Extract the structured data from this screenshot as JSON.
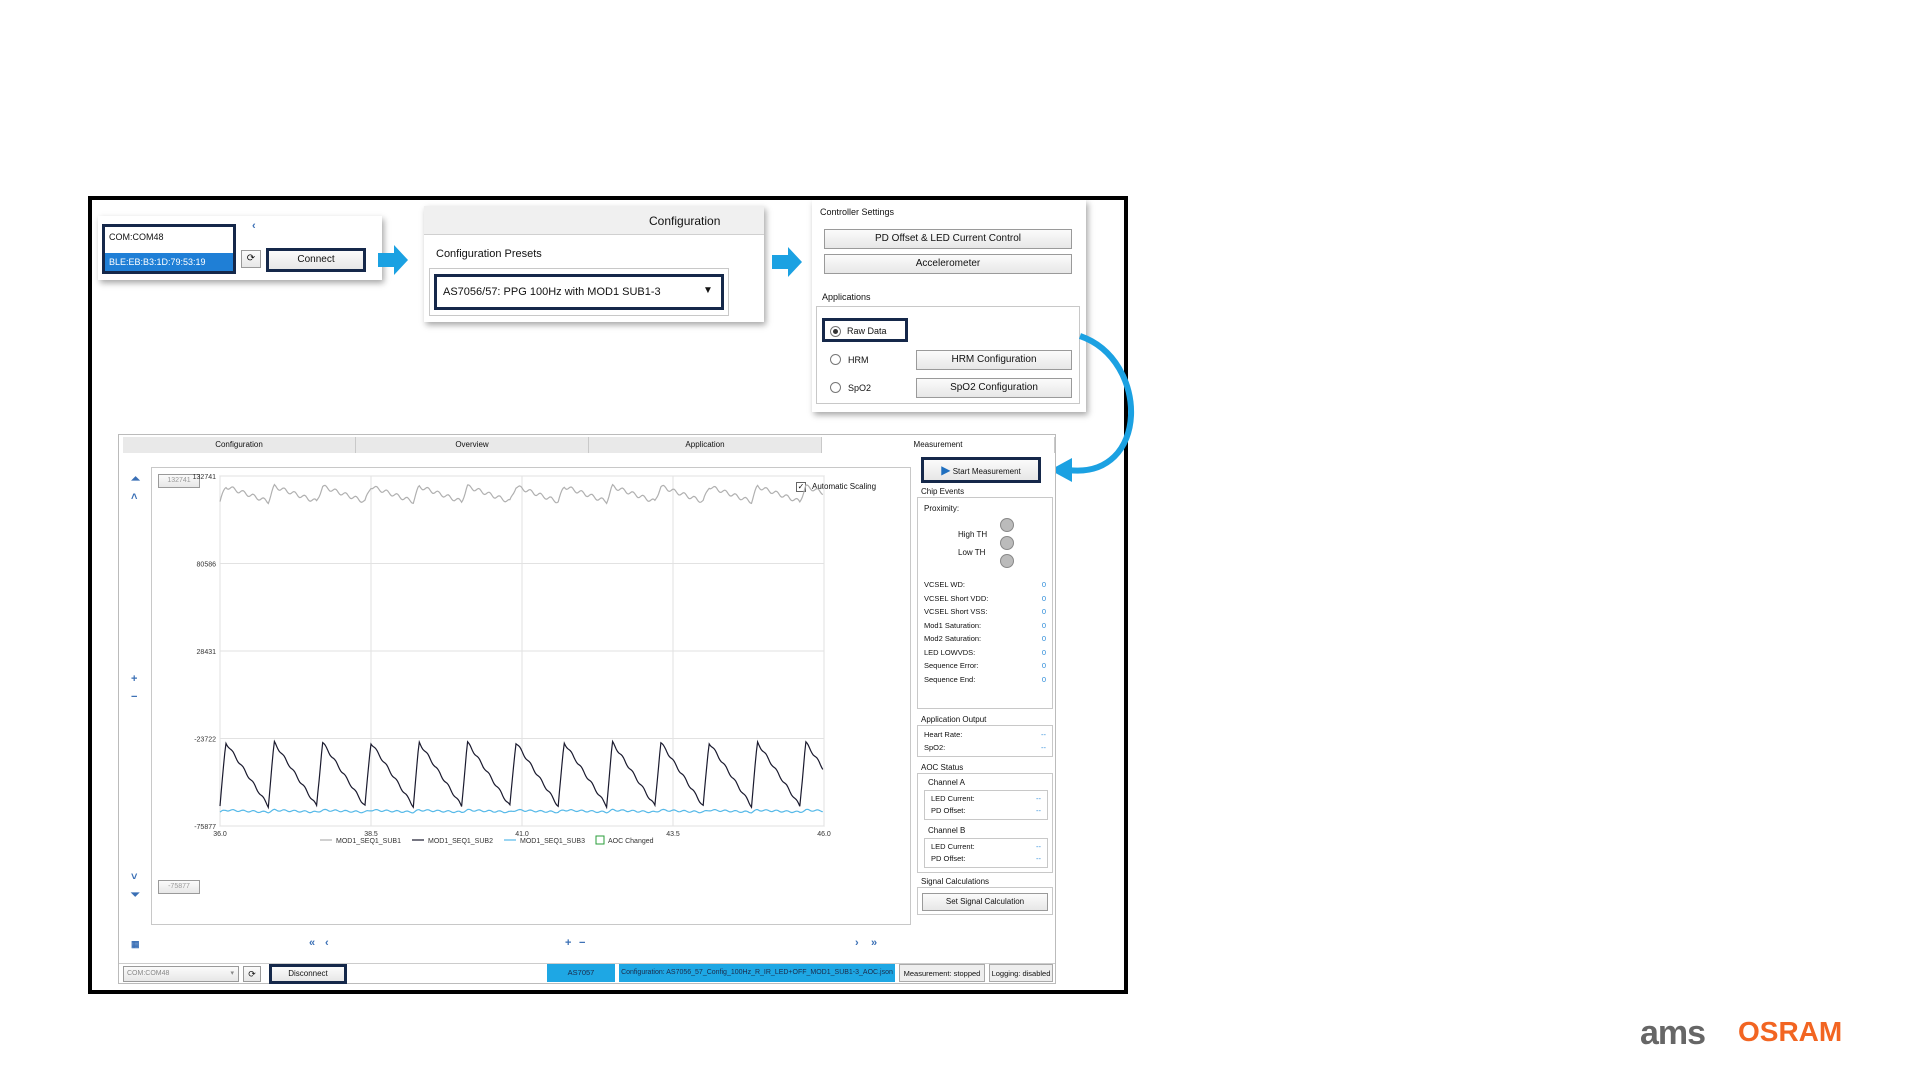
{
  "connection": {
    "port_items": [
      "COM:COM48",
      "BLE:EB:B3:1D:79:53:19"
    ],
    "connect_label": "Connect"
  },
  "configuration": {
    "header": "Configuration",
    "presets_label": "Configuration Presets",
    "preset_value": "AS7056/57: PPG 100Hz with MOD1 SUB1-3"
  },
  "controller": {
    "title": "Controller Settings",
    "pd_offset_label": "PD Offset & LED Current Control",
    "accelerometer_label": "Accelerometer",
    "applications_label": "Applications",
    "apps": [
      {
        "label": "Raw Data",
        "selected": true
      },
      {
        "label": "HRM",
        "selected": false,
        "button": "HRM Configuration"
      },
      {
        "label": "SpO2",
        "selected": false,
        "button": "SpO2 Configuration"
      }
    ]
  },
  "tabs": [
    "Configuration",
    "Overview",
    "Application",
    "Measurement"
  ],
  "chart_controls": {
    "ymax_box": "132741",
    "ymin_box": "-75877",
    "auto_scaling_label": "Automatic Scaling"
  },
  "chart_data": {
    "type": "line",
    "x_ticks": [
      "36.0",
      "38.5",
      "41.0",
      "43.5",
      "46.0"
    ],
    "y_ticks": [
      "132741",
      "80586",
      "28431",
      "-23722",
      "-75877"
    ],
    "xlim": [
      36.0,
      46.0
    ],
    "ylim": [
      -75877,
      132741
    ],
    "series": [
      {
        "name": "MOD1_SEQ1_SUB1",
        "color": "#b0b0b0"
      },
      {
        "name": "MOD1_SEQ1_SUB2",
        "color": "#1a1a2e"
      },
      {
        "name": "MOD1_SEQ1_SUB3",
        "color": "#56b9e8"
      }
    ],
    "extra_legend": "AOC Changed",
    "period": 0.8,
    "sub1": {
      "baseline": 122000,
      "amplitude": 9000
    },
    "sub2": {
      "baseline": -45000,
      "amplitude": 38000
    },
    "sub3": {
      "baseline": -67000,
      "amplitude": 1200
    }
  },
  "right_panel": {
    "start_label": "Start Measurement",
    "chip_events_title": "Chip Events",
    "proximity_label": "Proximity:",
    "high_th": "High TH",
    "low_th": "Low TH",
    "events": [
      {
        "label": "VCSEL WD:",
        "value": "0"
      },
      {
        "label": "VCSEL Short VDD:",
        "value": "0"
      },
      {
        "label": "VCSEL Short VSS:",
        "value": "0"
      },
      {
        "label": "Mod1 Saturation:",
        "value": "0"
      },
      {
        "label": "Mod2 Saturation:",
        "value": "0"
      },
      {
        "label": "LED LOWVDS:",
        "value": "0"
      },
      {
        "label": "Sequence Error:",
        "value": "0"
      },
      {
        "label": "Sequence End:",
        "value": "0"
      }
    ],
    "app_output_title": "Application Output",
    "heart_rate_label": "Heart Rate:",
    "heart_rate_value": "--",
    "spo2_label": "SpO2:",
    "spo2_value": "--",
    "aoc_title": "AOC Status",
    "channel_a": "Channel A",
    "channel_b": "Channel B",
    "led_current_label": "LED Current:",
    "pd_offset_label": "PD Offset:",
    "dash": "--",
    "signal_calc_title": "Signal Calculations",
    "set_signal_label": "Set Signal Calculation"
  },
  "status_bar": {
    "port": "COM:COM48",
    "disconnect_label": "Disconnect",
    "device": "AS7057",
    "configuration": "Configuration: AS7056_57_Config_100Hz_R_IR_LED+OFF_MOD1_SUB1-3_AOC.json",
    "measurement": "Measurement: stopped",
    "logging": "Logging: disabled"
  },
  "brand": {
    "left": "ams",
    "right": "OSRAM",
    "accent": "#f26522",
    "highlight": "#15284a",
    "arrow": "#1ba1e2"
  }
}
